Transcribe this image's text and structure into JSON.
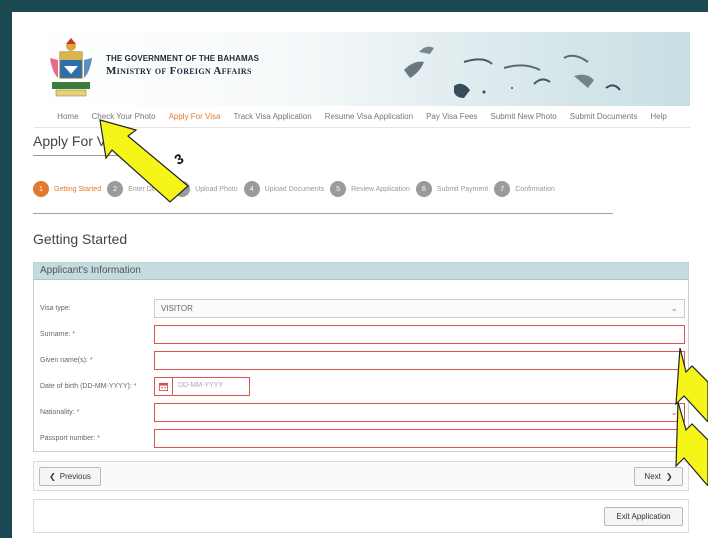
{
  "banner": {
    "gov_line1": "THE GOVERNMENT OF THE BAHAMAS",
    "gov_line2": "Ministry of Foreign Affairs"
  },
  "nav": {
    "items": [
      {
        "label": "Home",
        "active": false
      },
      {
        "label": "Check Your Photo",
        "active": false
      },
      {
        "label": "Apply For Visa",
        "active": true
      },
      {
        "label": "Track Visa Application",
        "active": false
      },
      {
        "label": "Resume Visa Application",
        "active": false
      },
      {
        "label": "Pay Visa Fees",
        "active": false
      },
      {
        "label": "Submit New Photo",
        "active": false
      },
      {
        "label": "Submit Documents",
        "active": false
      },
      {
        "label": "Help",
        "active": false
      }
    ]
  },
  "page_title": "Apply For Visa",
  "steps": [
    {
      "num": "1",
      "label": "Getting Started",
      "active": true
    },
    {
      "num": "2",
      "label": "Enter Details",
      "active": false
    },
    {
      "num": "3",
      "label": "Upload Photo",
      "active": false
    },
    {
      "num": "4",
      "label": "Upload Documents",
      "active": false
    },
    {
      "num": "5",
      "label": "Review Application",
      "active": false
    },
    {
      "num": "6",
      "label": "Submit Payment",
      "active": false
    },
    {
      "num": "7",
      "label": "Confirmation",
      "active": false
    }
  ],
  "section_title": "Getting Started",
  "panel": {
    "heading": "Applicant's Information",
    "visa_type": {
      "label": "Visa type:",
      "value": "VISITOR"
    },
    "surname": {
      "label": "Surname:",
      "value": ""
    },
    "given_names": {
      "label": "Given name(s):",
      "value": ""
    },
    "dob": {
      "label": "Date of birth (DD-MM-YYYY):",
      "placeholder": "DD-MM-YYYY"
    },
    "nationality": {
      "label": "Nationality:",
      "value": ""
    },
    "passport": {
      "label": "Passport number:",
      "value": ""
    },
    "required_mark": "*"
  },
  "buttons": {
    "previous": "Previous",
    "next": "Next",
    "exit": "Exit Application"
  },
  "annotations": {
    "callout_3": "3"
  },
  "colors": {
    "accent": "#e07a2e",
    "error": "#d9534f",
    "panel_head": "#c4dbe0",
    "callout": "#f5f51a"
  }
}
